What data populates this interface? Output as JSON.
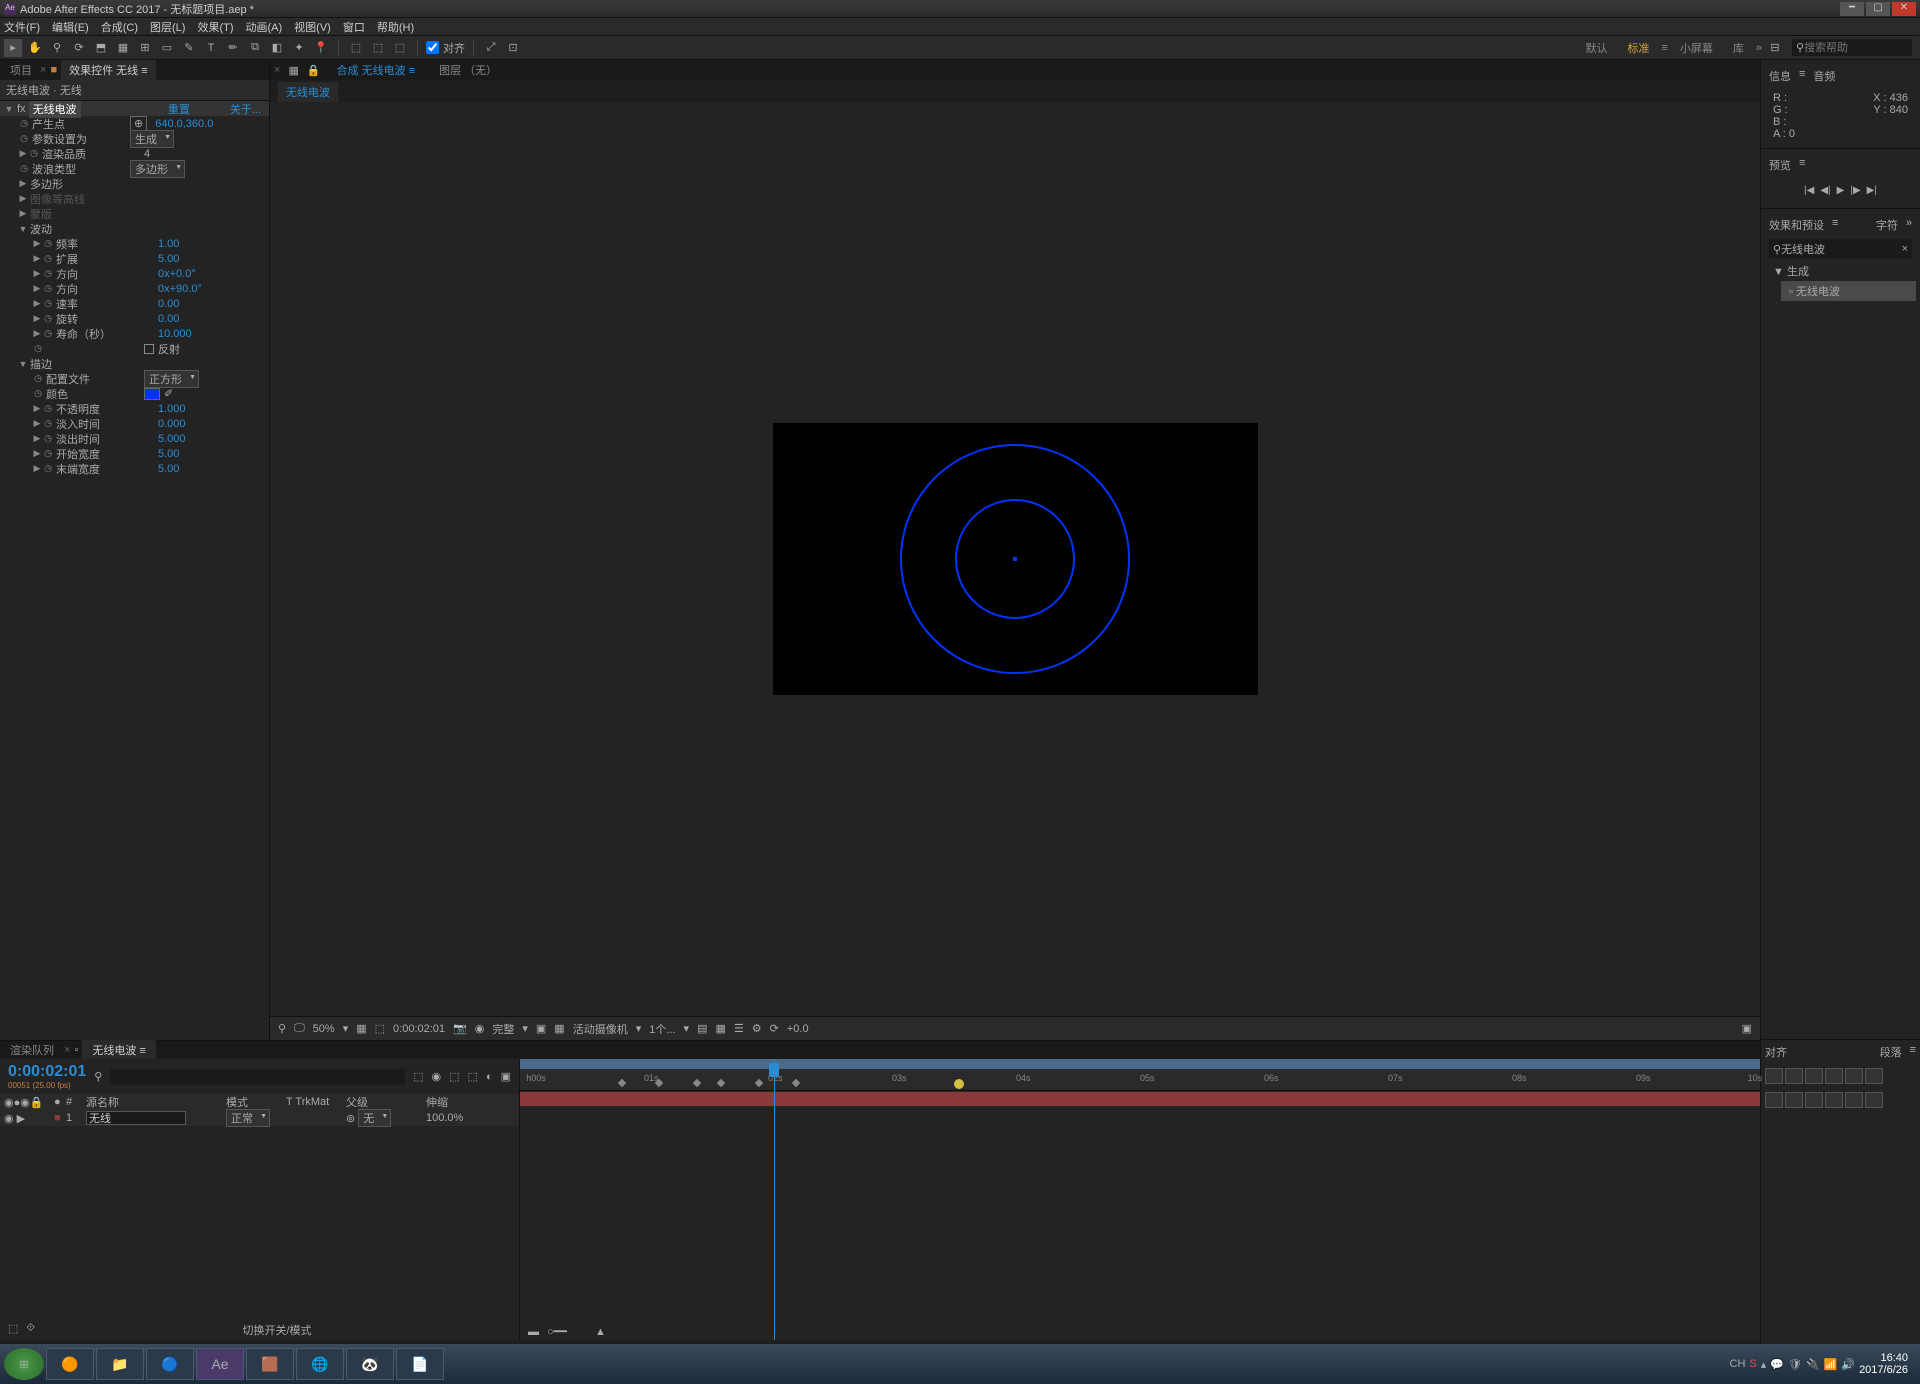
{
  "titlebar": {
    "app": "Adobe After Effects CC 2017 - 无标题项目.aep *"
  },
  "menu": [
    "文件(F)",
    "编辑(E)",
    "合成(C)",
    "图层(L)",
    "效果(T)",
    "动画(A)",
    "视图(V)",
    "窗口",
    "帮助(H)"
  ],
  "toolbar": {
    "snap_label": "对齐"
  },
  "workspace_labels": {
    "default": "默认",
    "standard": "标准",
    "small": "小屏幕",
    "lib": "库"
  },
  "search_placeholder": "搜索帮助",
  "left_tabs": {
    "project": "项目",
    "effect_controls": "效果控件 无线"
  },
  "effect_header": "无线电波 · 无线",
  "effect_name": "无线电波",
  "reset": "重置",
  "about": "关于...",
  "props": {
    "producer": {
      "label": "产生点",
      "value": "640.0,360.0"
    },
    "param_setting": {
      "label": "参数设置为",
      "value": "生成"
    },
    "render_quality": {
      "label": "渲染品质",
      "value": "4"
    },
    "wave_type": {
      "label": "波浪类型",
      "value": "多边形"
    },
    "polygon": {
      "label": "多边形"
    },
    "image_contour": {
      "label": "图像等高线"
    },
    "mask": {
      "label": "蒙版"
    },
    "wave_motion": {
      "label": "波动"
    },
    "frequency": {
      "label": "频率",
      "value": "1.00"
    },
    "expansion": {
      "label": "扩展",
      "value": "5.00"
    },
    "direction": {
      "label": "方向",
      "value": "0x+0.0°"
    },
    "direction2": {
      "label": "方向",
      "value": "0x+90.0°"
    },
    "velocity": {
      "label": "速率",
      "value": "0.00"
    },
    "spin": {
      "label": "旋转",
      "value": "0.00"
    },
    "lifespan": {
      "label": "寿命（秒）",
      "value": "10.000"
    },
    "reflection": {
      "label": "反射"
    },
    "stroke": {
      "label": "描边"
    },
    "profile": {
      "label": "配置文件",
      "value": "正方形"
    },
    "color": {
      "label": "颜色"
    },
    "opacity": {
      "label": "不透明度",
      "value": "1.000"
    },
    "fade_in": {
      "label": "淡入时间",
      "value": "0.000"
    },
    "fade_out": {
      "label": "淡出时间",
      "value": "5.000"
    },
    "start_width": {
      "label": "开始宽度",
      "value": "5.00"
    },
    "end_width": {
      "label": "末端宽度",
      "value": "5.00"
    }
  },
  "comp_tabs": {
    "comp": "合成 无线电波",
    "layer": "图层 （无）"
  },
  "comp_name": "无线电波",
  "viewer": {
    "zoom": "50%",
    "timecode": "0:00:02:01",
    "full": "完整",
    "camera": "活动摄像机",
    "views": "1个...",
    "exposure": "+0.0"
  },
  "info_panel": {
    "tab_info": "信息",
    "tab_audio": "音频",
    "r": "R :",
    "g": "G :",
    "b": "B :",
    "a": "A : 0",
    "x": "X : 436",
    "y": "Y : 840"
  },
  "preview_tab": "预览",
  "effects_presets_tab": "效果和预设",
  "char_tab": "字符",
  "preset_search": "无线电波",
  "preset_tree": {
    "generate": "生成",
    "radio_waves": "无线电波"
  },
  "timeline": {
    "render_queue": "渲染队列",
    "comp_tab": "无线电波",
    "timecode": "0:00:02:01",
    "sub": "00051 (25.00 fps)",
    "cols": {
      "num": "#",
      "source": "源名称",
      "mode": "模式",
      "trkmat": "T  TrkMat",
      "parent": "父级",
      "stretch": "伸缩"
    },
    "layer1": {
      "num": "1",
      "name": "无线",
      "mode": "正常",
      "parent": "无",
      "stretch": "100.0%"
    },
    "ticks": [
      "h00s",
      "01s",
      "02s",
      "03s",
      "04s",
      "05s",
      "06s",
      "07s",
      "08s",
      "09s",
      "10s"
    ],
    "footer": "切换开关/模式"
  },
  "align_panel": {
    "align": "对齐",
    "paragraph": "段落"
  },
  "taskbar": {
    "time": "16:40",
    "date": "2017/6/26",
    "lang": "CH"
  }
}
